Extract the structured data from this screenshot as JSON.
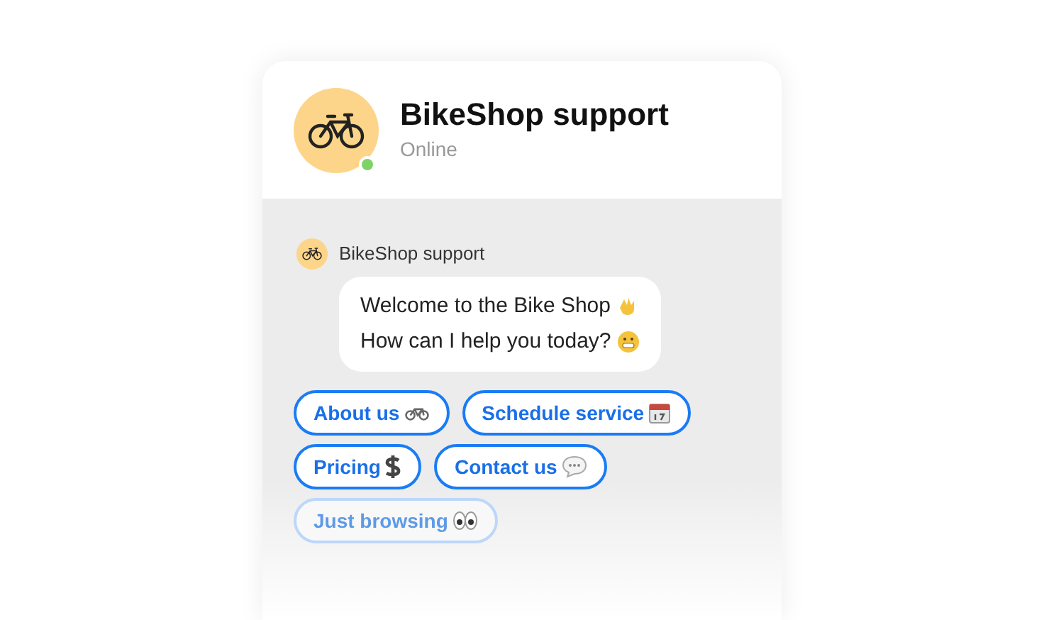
{
  "header": {
    "title": "BikeShop support",
    "status": "Online",
    "online": true
  },
  "message": {
    "sender": "BikeShop support",
    "lines": [
      "Welcome to the Bike Shop",
      "How can I help you today?"
    ]
  },
  "options": [
    {
      "label": "About us",
      "faded": false
    },
    {
      "label": "Schedule service",
      "faded": false
    },
    {
      "label": "Pricing",
      "faded": false
    },
    {
      "label": "Contact us",
      "faded": false
    },
    {
      "label": "Just browsing",
      "faded": true
    }
  ]
}
